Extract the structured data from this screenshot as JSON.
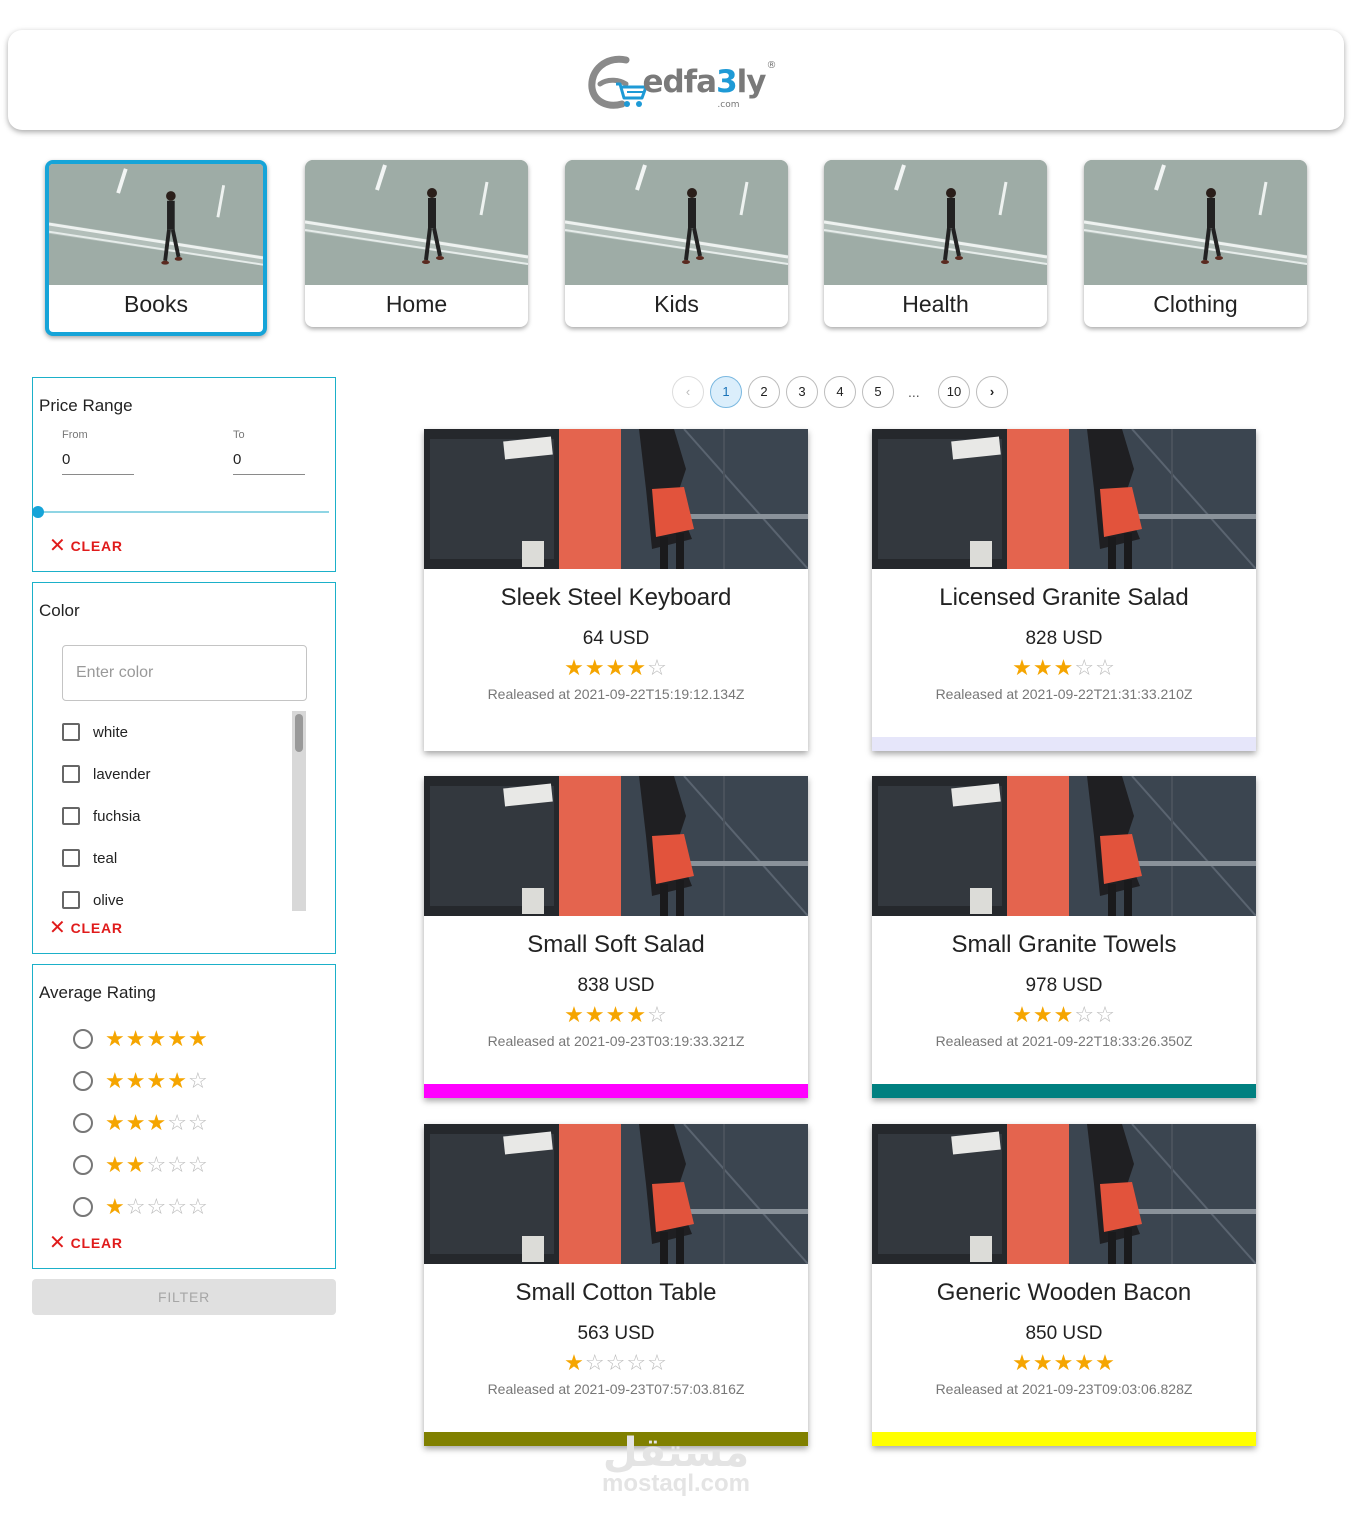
{
  "header": {
    "logo_prefix": "edfa",
    "logo_three": "3",
    "logo_suffix": "ly",
    "logo_com": ".com",
    "logo_reg": "®"
  },
  "categories": [
    {
      "label": "Books",
      "selected": true
    },
    {
      "label": "Home",
      "selected": false
    },
    {
      "label": "Kids",
      "selected": false
    },
    {
      "label": "Health",
      "selected": false
    },
    {
      "label": "Clothing",
      "selected": false
    }
  ],
  "filters": {
    "price": {
      "title": "Price Range",
      "from_label": "From",
      "from_value": "0",
      "to_label": "To",
      "to_value": "0",
      "clear_label": "CLEAR"
    },
    "color": {
      "title": "Color",
      "placeholder": "Enter color",
      "options": [
        "white",
        "lavender",
        "fuchsia",
        "teal",
        "olive"
      ],
      "clear_label": "CLEAR"
    },
    "rating": {
      "title": "Average Rating",
      "options": [
        5,
        4,
        3,
        2,
        1
      ],
      "clear_label": "CLEAR"
    },
    "filter_button": "FILTER"
  },
  "pagination": {
    "prev_icon": "‹",
    "next_icon": "›",
    "pages": [
      "1",
      "2",
      "3",
      "4",
      "5"
    ],
    "ellipsis": "...",
    "last": "10",
    "current": "1"
  },
  "products": [
    {
      "name": "Sleek Steel Keyboard",
      "price": "64 USD",
      "rating": 4,
      "released": "Realeased at 2021-09-22T15:19:12.134Z",
      "color": "#ffffff"
    },
    {
      "name": "Licensed Granite Salad",
      "price": "828 USD",
      "rating": 3,
      "released": "Realeased at 2021-09-22T21:31:33.210Z",
      "color": "#e6e6fa"
    },
    {
      "name": "Small Soft Salad",
      "price": "838 USD",
      "rating": 4,
      "released": "Realeased at 2021-09-23T03:19:33.321Z",
      "color": "#ff00ff"
    },
    {
      "name": "Small Granite Towels",
      "price": "978 USD",
      "rating": 3,
      "released": "Realeased at 2021-09-22T18:33:26.350Z",
      "color": "#008080"
    },
    {
      "name": "Small Cotton Table",
      "price": "563 USD",
      "rating": 1,
      "released": "Realeased at 2021-09-23T07:57:03.816Z",
      "color": "#808000"
    },
    {
      "name": "Generic Wooden Bacon",
      "price": "850 USD",
      "rating": 5,
      "released": "Realeased at 2021-09-23T09:03:06.828Z",
      "color": "#ffff00"
    }
  ],
  "watermark": {
    "arabic": "مستقل",
    "latin": "mostaql.com"
  }
}
